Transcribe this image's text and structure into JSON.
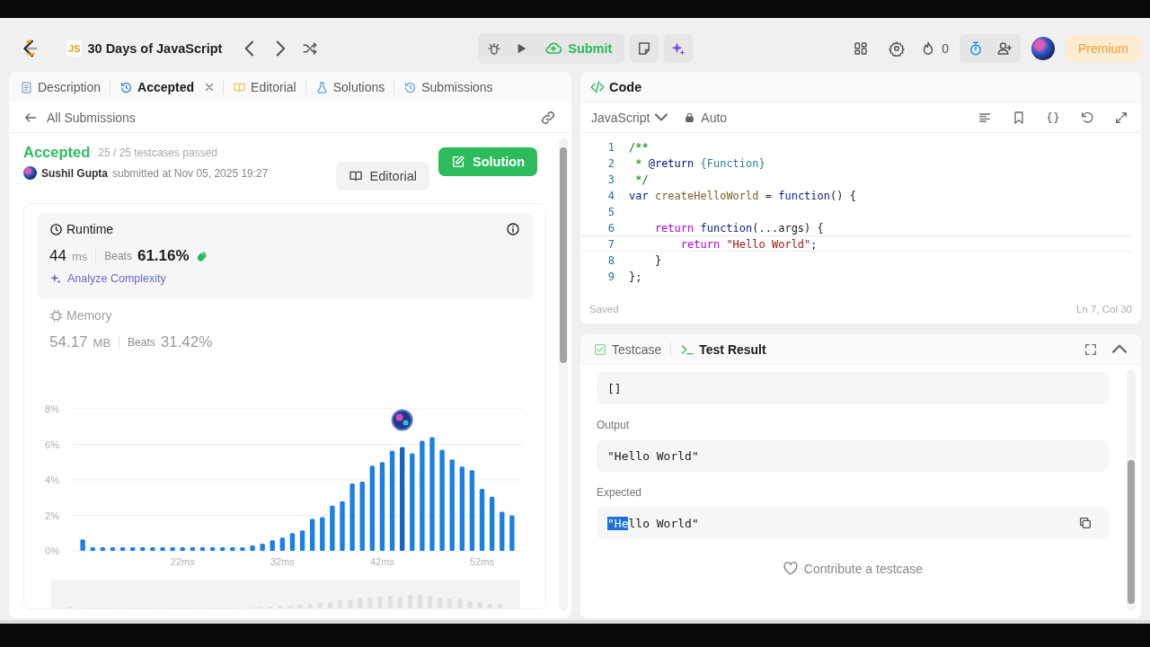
{
  "top_bar": {
    "badge": "JS",
    "title": "30 Days of JavaScript",
    "submit": "Submit",
    "streak": "0",
    "premium": "Premium"
  },
  "left_tabs": [
    {
      "label": "Description",
      "selected": false,
      "closable": false
    },
    {
      "label": "Accepted",
      "selected": true,
      "closable": true
    },
    {
      "label": "Editorial",
      "selected": false,
      "closable": false
    },
    {
      "label": "Solutions",
      "selected": false,
      "closable": false
    },
    {
      "label": "Submissions",
      "selected": false,
      "closable": false
    }
  ],
  "submission": {
    "back_label": "All Submissions",
    "status": "Accepted",
    "testcases": "25 / 25 testcases passed",
    "user": "Sushil Gupta",
    "submitted": "submitted at Nov 05, 2025 19:27",
    "buttons": [
      {
        "label": "Editorial",
        "kind": "secondary"
      },
      {
        "label": "Solution",
        "kind": "primary"
      }
    ]
  },
  "runtime": {
    "title": "Runtime",
    "value": "44",
    "unit": "ms",
    "beats_label": "Beats",
    "beats": "61.16%",
    "link": "Analyze Complexity",
    "selected": true
  },
  "memory": {
    "title": "Memory",
    "value": "54.17",
    "unit": "MB",
    "beats_label": "Beats",
    "beats": "31.42%",
    "selected": false
  },
  "chart_data": {
    "type": "bar",
    "x": [
      12,
      13,
      14,
      15,
      16,
      17,
      18,
      19,
      20,
      21,
      22,
      23,
      24,
      25,
      26,
      27,
      28,
      29,
      30,
      31,
      32,
      33,
      34,
      35,
      36,
      37,
      38,
      39,
      40,
      41,
      42,
      43,
      44,
      45,
      46,
      47,
      48,
      49,
      50,
      51,
      52,
      53,
      54,
      55
    ],
    "values": [
      0.65,
      0.2,
      0.2,
      0.2,
      0.2,
      0.2,
      0.2,
      0.2,
      0.2,
      0.2,
      0.2,
      0.2,
      0.2,
      0.2,
      0.2,
      0.2,
      0.2,
      0.3,
      0.4,
      0.6,
      0.75,
      1.0,
      1.15,
      1.8,
      1.9,
      2.55,
      2.8,
      3.8,
      3.9,
      4.8,
      5.0,
      5.65,
      5.85,
      5.5,
      6.2,
      6.4,
      5.7,
      5.15,
      4.75,
      4.55,
      3.5,
      3.05,
      2.2,
      2.0
    ],
    "xlim": [
      11,
      56
    ],
    "xticks": [
      {
        "value": 22,
        "label": "22ms"
      },
      {
        "value": 32,
        "label": "32ms"
      },
      {
        "value": 42,
        "label": "42ms"
      },
      {
        "value": 52,
        "label": "52ms"
      }
    ],
    "yticks": [
      {
        "value": 0,
        "label": "0%"
      },
      {
        "value": 2,
        "label": "2%"
      },
      {
        "value": 4,
        "label": "4%"
      },
      {
        "value": 6,
        "label": "6%"
      },
      {
        "value": 8,
        "label": "8%"
      }
    ],
    "ylim": [
      0,
      8
    ],
    "grid": true
  },
  "code_panel": {
    "title": "Code",
    "language": "JavaScript",
    "mode": "Auto",
    "status": "Saved",
    "cursor": "Ln 7, Col 30",
    "lines": [
      {
        "number": "1",
        "current": false,
        "tokens": [
          {
            "text": "/**",
            "kind": "comment"
          }
        ]
      },
      {
        "number": "2",
        "current": false,
        "tokens": [
          {
            "text": " * ",
            "kind": "comment"
          },
          {
            "text": "@return",
            "kind": "tag"
          },
          {
            "text": " {Function}",
            "kind": "type"
          }
        ]
      },
      {
        "number": "3",
        "current": false,
        "tokens": [
          {
            "text": " */",
            "kind": "comment"
          }
        ]
      },
      {
        "number": "4",
        "current": false,
        "tokens": [
          {
            "text": "var",
            "kind": "keyword"
          },
          {
            "text": " createHelloWorld",
            "kind": "name"
          },
          {
            "text": " = ",
            "kind": "plain"
          },
          {
            "text": "function",
            "kind": "keyword"
          },
          {
            "text": "() {",
            "kind": "plain"
          }
        ]
      },
      {
        "number": "5",
        "current": false
      },
      {
        "number": "6",
        "current": false,
        "tokens": [
          {
            "text": "    return",
            "kind": "control"
          },
          {
            "text": " function",
            "kind": "keyword"
          },
          {
            "text": "(...args) {",
            "kind": "plain"
          }
        ]
      },
      {
        "number": "7",
        "current": true,
        "tokens": [
          {
            "text": "        return",
            "kind": "control"
          },
          {
            "text": " \"Hello World\"",
            "kind": "string"
          },
          {
            "text": ";",
            "kind": "plain"
          }
        ]
      },
      {
        "number": "8",
        "current": false,
        "tokens": [
          {
            "text": "    }",
            "kind": "plain"
          }
        ]
      },
      {
        "number": "9",
        "current": false,
        "tokens": [
          {
            "text": "};",
            "kind": "plain"
          }
        ]
      }
    ]
  },
  "test_panel": {
    "tabs": [
      {
        "label": "Testcase",
        "selected": false
      },
      {
        "label": "Test Result",
        "selected": true
      }
    ],
    "sections": [
      {
        "parts": [
          {
            "text": "[]",
            "selected": false
          }
        ],
        "copy": false
      },
      {
        "label": "Output",
        "parts": [
          {
            "text": "\"Hello World\"",
            "selected": false
          }
        ],
        "copy": false
      },
      {
        "label": "Expected",
        "parts": [
          {
            "text": "\"He",
            "selected": true
          },
          {
            "text": "llo World\"",
            "selected": false
          }
        ],
        "copy": true
      }
    ],
    "contribute": "Contribute a testcase"
  }
}
